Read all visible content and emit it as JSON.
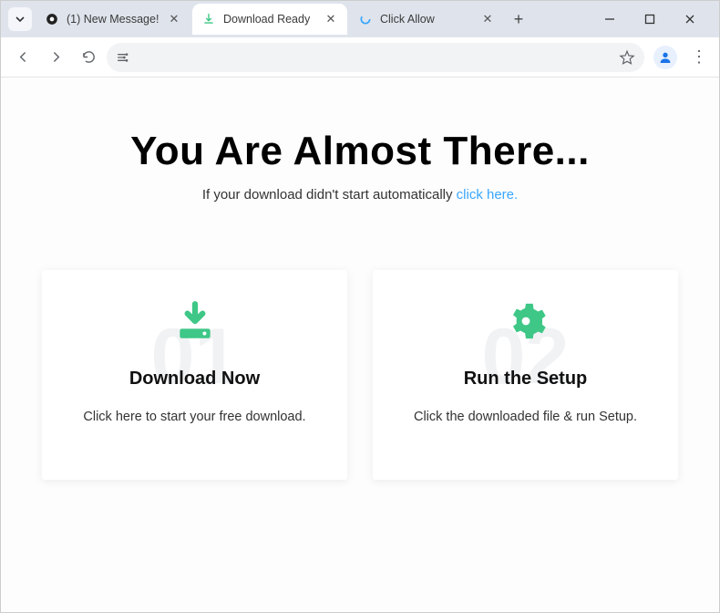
{
  "browser": {
    "tabs": [
      {
        "title": "(1) New Message!",
        "active": false
      },
      {
        "title": "Download Ready",
        "active": true
      },
      {
        "title": "Click Allow",
        "active": false
      }
    ],
    "address_value": ""
  },
  "page": {
    "heading": "You Are Almost There...",
    "sub_prefix": "If your download didn't start automatically ",
    "sub_link": "click here.",
    "cards": [
      {
        "num": "01",
        "title": "Download Now",
        "desc": "Click here to start your free download."
      },
      {
        "num": "02",
        "title": "Run the Setup",
        "desc": "Click the downloaded file & run Setup."
      }
    ]
  }
}
